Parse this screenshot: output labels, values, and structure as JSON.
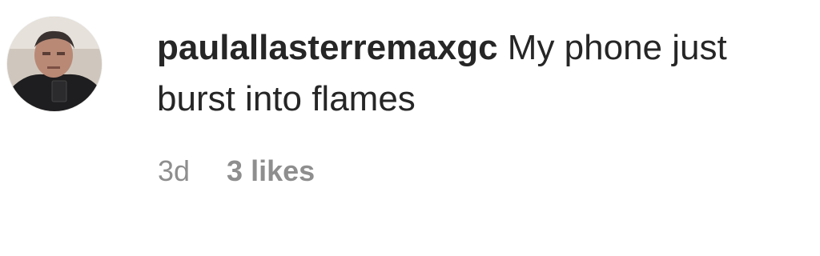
{
  "comment": {
    "avatar_icon": "user-avatar-photo",
    "username": "paulallasterremaxgc",
    "text": "My phone just burst into flames",
    "timestamp": "3d",
    "likes": "3 likes"
  },
  "colors": {
    "text": "#262626",
    "meta": "#8e8e8e",
    "background": "#ffffff"
  }
}
